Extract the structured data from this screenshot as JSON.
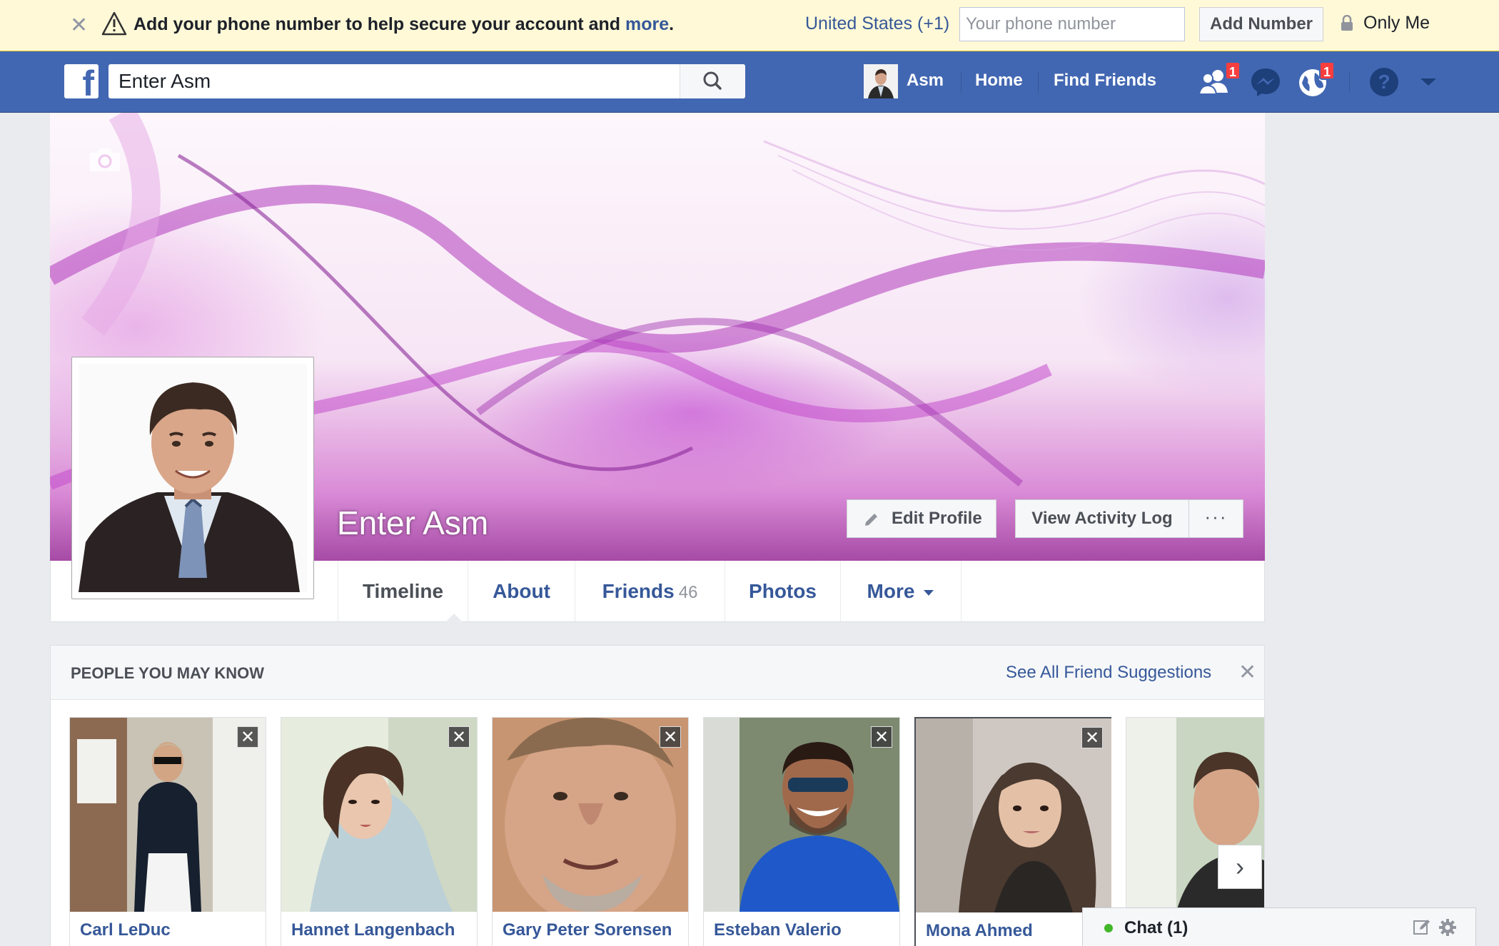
{
  "banner": {
    "message": "Add your phone number to help secure your account and ",
    "more_link": "more",
    "period": ".",
    "country": "United States (+1)",
    "phone_placeholder": "Your phone number",
    "add_button": "Add Number",
    "privacy": "Only Me",
    "icons": [
      "close-icon",
      "warning-icon",
      "lock-icon"
    ]
  },
  "topbar": {
    "search_value": "Enter Asm",
    "user_name": "Asm",
    "home": "Home",
    "find_friends": "Find Friends",
    "friend_requests_badge": "1",
    "notifications_badge": "1",
    "brand_color": "#4267b2"
  },
  "profile": {
    "name": "Enter Asm",
    "edit_profile": "Edit Profile",
    "view_activity_log": "View Activity Log",
    "more_dots": "···"
  },
  "tabs": {
    "timeline": "Timeline",
    "about": "About",
    "friends": "Friends",
    "friends_count": "46",
    "photos": "Photos",
    "more": "More"
  },
  "pymk": {
    "title": "PEOPLE YOU MAY KNOW",
    "see_all": "See All Friend Suggestions",
    "people": [
      {
        "name": "Carl LeDuc"
      },
      {
        "name": "Hannet Langenbach"
      },
      {
        "name": "Gary Peter Sorensen"
      },
      {
        "name": "Esteban Valerio"
      },
      {
        "name": "Mona Ahmed"
      },
      {
        "name": ""
      }
    ]
  },
  "chat": {
    "label": "Chat (1)"
  }
}
